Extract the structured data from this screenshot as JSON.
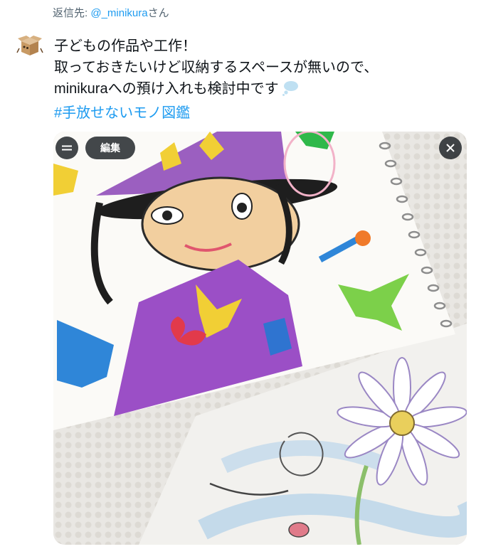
{
  "reply": {
    "prefix": "返信先: ",
    "handle": "@_minikura",
    "suffix": "さん"
  },
  "tweet": {
    "line1": "子どもの作品や工作！",
    "line2": "取っておきたいけど収納するスペースが無いので、",
    "line3": "minikuraへの預け入れも検討中です",
    "hashtag": "#手放せないモノ図鑑"
  },
  "media": {
    "edit_label": "編集",
    "menu_icon": "drag-handle-icon",
    "close_icon": "close-icon"
  },
  "colors": {
    "link": "#1d9bf0",
    "text": "#0f1419",
    "muted": "#536471",
    "overlay": "#0f1419"
  }
}
